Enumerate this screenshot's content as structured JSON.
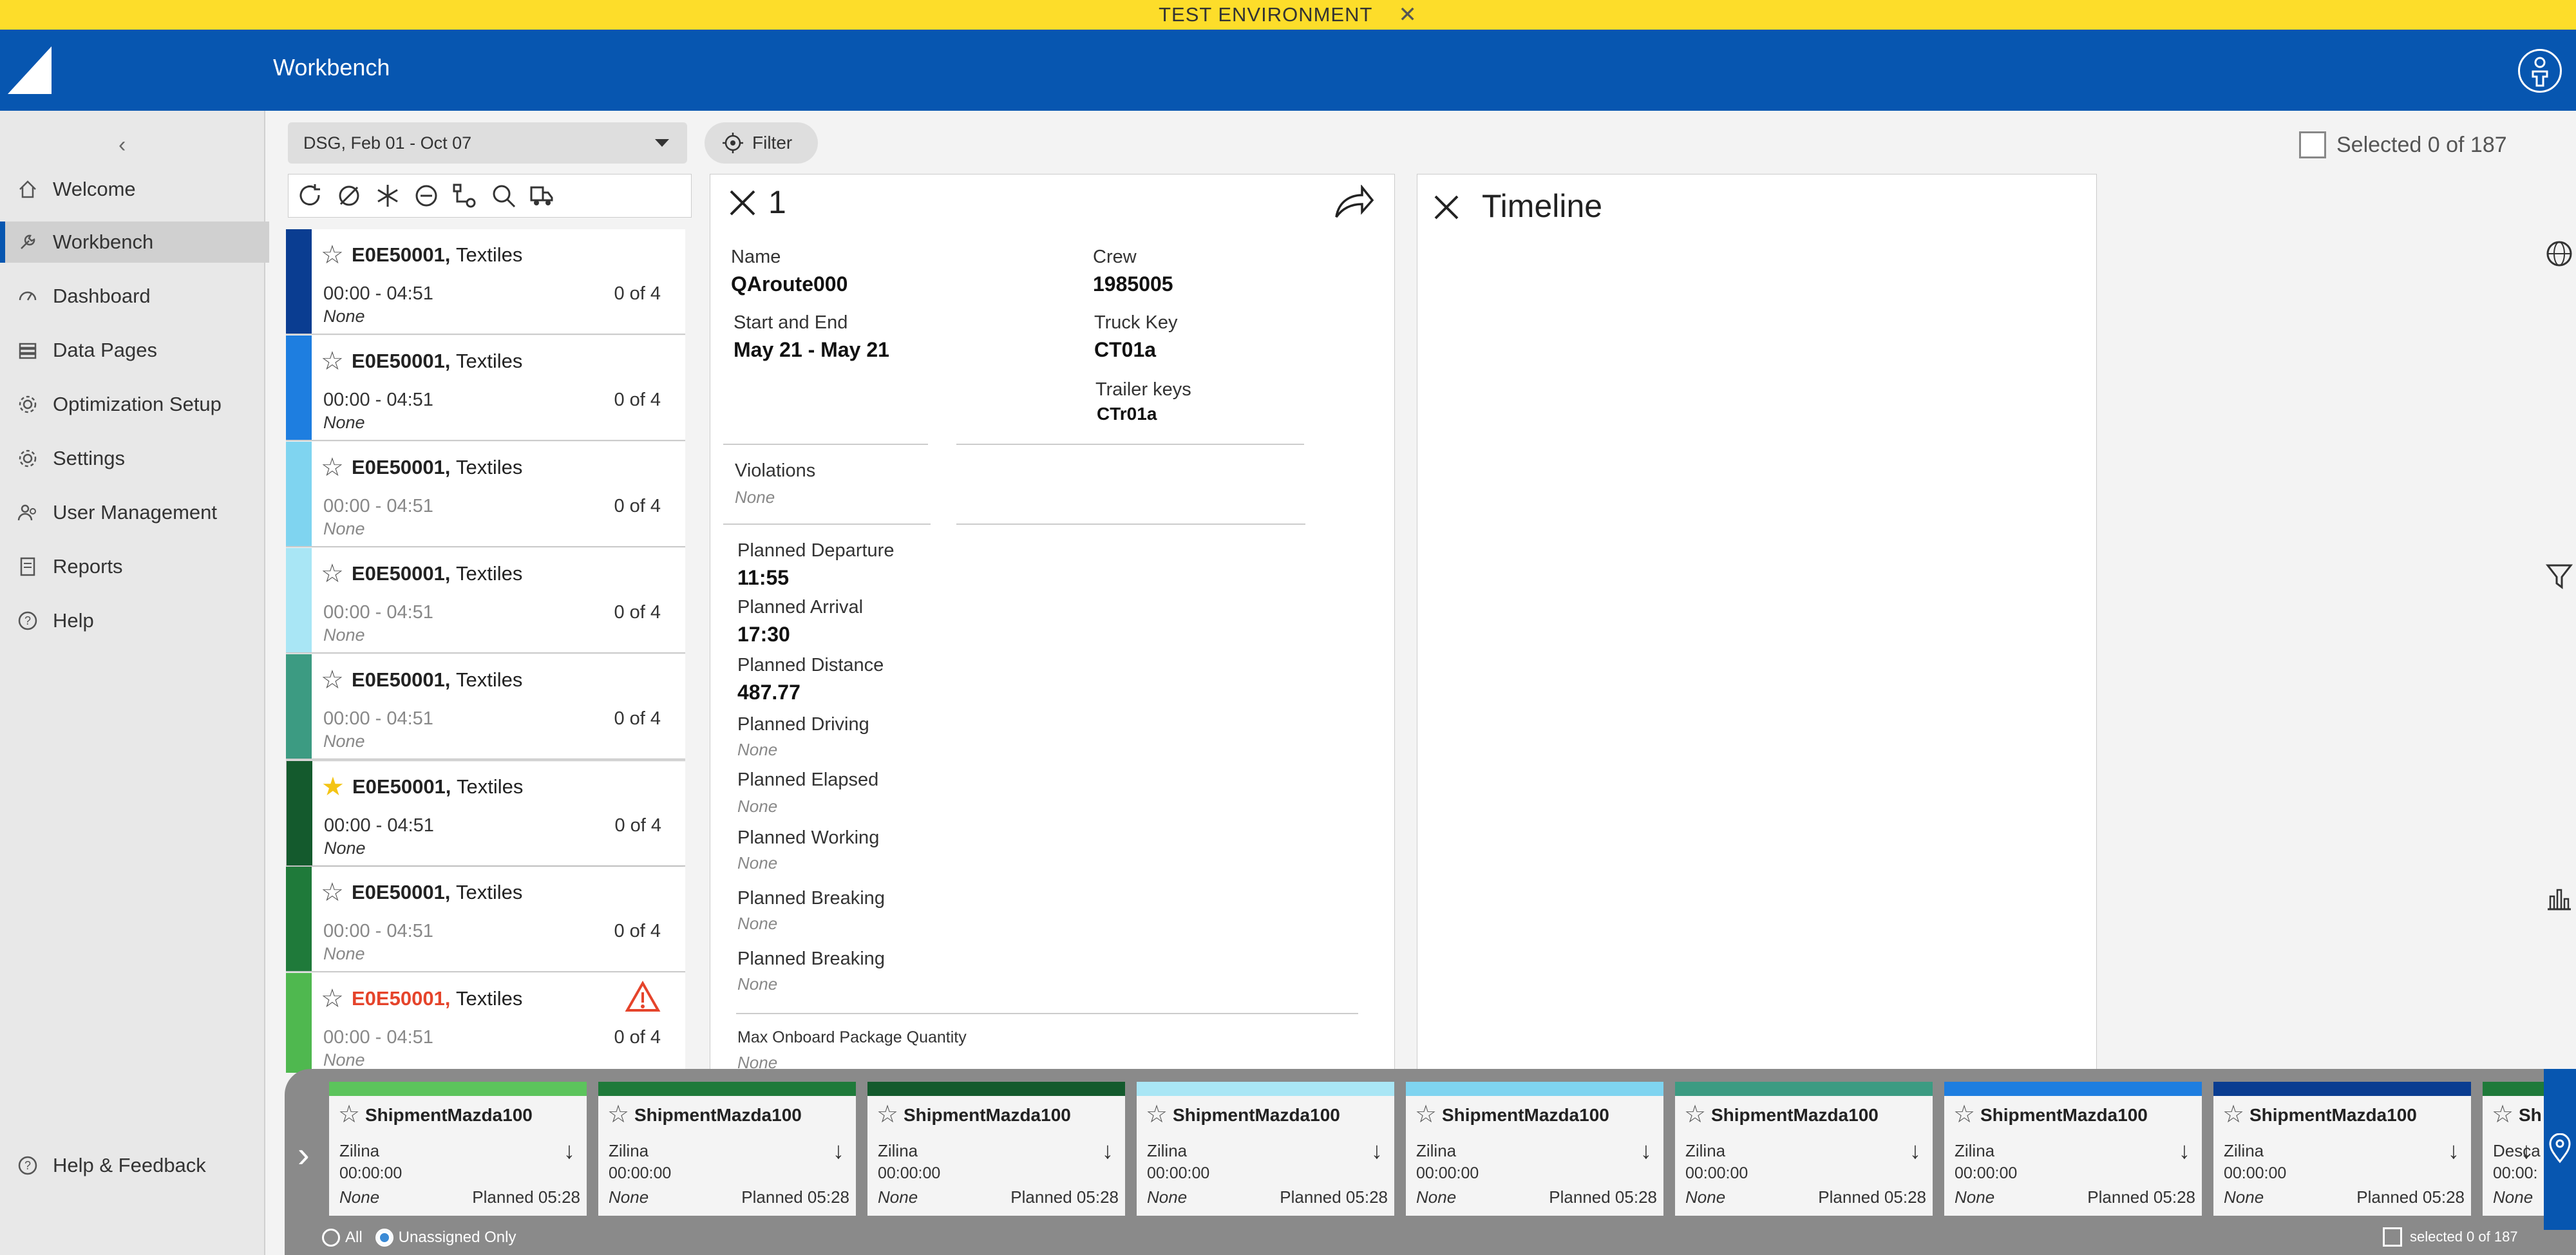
{
  "banner": {
    "text": "TEST ENVIRONMENT",
    "close": "✕"
  },
  "header": {
    "title": "Workbench"
  },
  "sidebar": {
    "collapse": "‹",
    "items": [
      {
        "label": "Welcome",
        "icon": "home-icon"
      },
      {
        "label": "Workbench",
        "icon": "wrench-icon",
        "active": true
      },
      {
        "label": "Dashboard",
        "icon": "dashboard-icon"
      },
      {
        "label": "Data Pages",
        "icon": "database-icon"
      },
      {
        "label": "Optimization Setup",
        "icon": "gear-icon"
      },
      {
        "label": "Settings",
        "icon": "gear-icon"
      },
      {
        "label": "User Management",
        "icon": "users-icon"
      },
      {
        "label": "Reports",
        "icon": "report-icon"
      },
      {
        "label": "Help",
        "icon": "help-icon"
      }
    ],
    "feedback": "Help & Feedback"
  },
  "toolbar": {
    "date_range": "DSG, Feb 01 - Oct 07",
    "filter_label": "Filter",
    "selected_text": "Selected 0 of 187"
  },
  "routes": [
    {
      "id": "E0E50001,",
      "cat": "Textiles",
      "time": "00:00 - 04:51",
      "count": "0 of 4",
      "none": "None",
      "colors": [
        "#0a3d91"
      ],
      "fav": false,
      "dim": false
    },
    {
      "id": "E0E50001,",
      "cat": "Textiles",
      "time": "00:00 - 04:51",
      "count": "0 of 4",
      "none": "None",
      "colors": [
        "#1e7ee0"
      ],
      "fav": false,
      "dim": false
    },
    {
      "id": "E0E50001,",
      "cat": "Textiles",
      "time": "00:00 - 04:51",
      "count": "0 of 4",
      "none": "None",
      "colors": [
        "#7fd4f0"
      ],
      "fav": false,
      "dim": true
    },
    {
      "id": "E0E50001,",
      "cat": "Textiles",
      "time": "00:00 - 04:51",
      "count": "0 of 4",
      "none": "None",
      "colors": [
        "#a9e6f5"
      ],
      "fav": false,
      "dim": true
    },
    {
      "id": "E0E50001,",
      "cat": "Textiles",
      "time": "00:00 - 04:51",
      "count": "0 of 4",
      "none": "None",
      "colors": [
        "#3c9b82"
      ],
      "fav": false,
      "dim": true
    },
    {
      "id": "E0E50001,",
      "cat": "Textiles",
      "time": "00:00 - 04:51",
      "count": "0 of 4",
      "none": "None",
      "colors": [
        "#145a2d"
      ],
      "fav": true,
      "dim": false
    },
    {
      "id": "E0E50001,",
      "cat": "Textiles",
      "time": "00:00 - 04:51",
      "count": "0 of 4",
      "none": "None",
      "colors": [
        "#1f7a3a"
      ],
      "fav": false,
      "dim": true
    },
    {
      "id": "E0E50001,",
      "cat": "Textiles",
      "time": "00:00 - 04:51",
      "count": "0 of 4",
      "none": "None",
      "colors": [
        "#4fb84f"
      ],
      "fav": false,
      "dim": true,
      "warn": true,
      "red": true
    }
  ],
  "details": {
    "title": "1",
    "name_label": "Name",
    "name": "QAroute000",
    "crew_label": "Crew",
    "crew": "1985005",
    "se_label": "Start and End",
    "se": "May 21 - May 21",
    "truck_label": "Truck Key",
    "truck": "CT01a",
    "trailer_label": "Trailer keys",
    "trailer": "CTr01a",
    "violations_label": "Violations",
    "violations": "None",
    "pd_label": "Planned Departure",
    "pd": "11:55",
    "pa_label": "Planned Arrival",
    "pa": "17:30",
    "pdist_label": "Planned Distance",
    "pdist": "487.77",
    "pdrive_label": "Planned Driving",
    "pdrive": "None",
    "pelapsed_label": "Planned Elapsed",
    "pelapsed": "None",
    "pwork_label": "Planned Working",
    "pwork": "None",
    "pbreak1_label": "Planned Breaking",
    "pbreak1": "None",
    "pbreak2_label": "Planned Breaking",
    "pbreak2": "None",
    "maxpkg_label": "Max Onboard Package Quantity",
    "maxpkg": "None"
  },
  "timeline": {
    "title": "Timeline"
  },
  "shipments": [
    {
      "name": "ShipmentMazda100",
      "city": "Zilina",
      "clock": "00:00:00",
      "none": "None",
      "planned": "Planned 05:28",
      "color": "#5cc45c"
    },
    {
      "name": "ShipmentMazda100",
      "city": "Zilina",
      "clock": "00:00:00",
      "none": "None",
      "planned": "Planned 05:28",
      "color": "#1f7a3a"
    },
    {
      "name": "ShipmentMazda100",
      "city": "Zilina",
      "clock": "00:00:00",
      "none": "None",
      "planned": "Planned 05:28",
      "color": "#145a2d"
    },
    {
      "name": "ShipmentMazda100",
      "city": "Zilina",
      "clock": "00:00:00",
      "none": "None",
      "planned": "Planned 05:28",
      "color": "#a9e6f5"
    },
    {
      "name": "ShipmentMazda100",
      "city": "Zilina",
      "clock": "00:00:00",
      "none": "None",
      "planned": "Planned 05:28",
      "color": "#7fd4f0"
    },
    {
      "name": "ShipmentMazda100",
      "city": "Zilina",
      "clock": "00:00:00",
      "none": "None",
      "planned": "Planned 05:28",
      "color": "#3c9b82"
    },
    {
      "name": "ShipmentMazda100",
      "city": "Zilina",
      "clock": "00:00:00",
      "none": "None",
      "planned": "Planned 05:28",
      "color": "#1e7ee0"
    },
    {
      "name": "ShipmentMazda100",
      "city": "Zilina",
      "clock": "00:00:00",
      "none": "None",
      "planned": "Planned 05:28",
      "color": "#0a3d91"
    },
    {
      "name": "Sh",
      "city": "Desca",
      "clock": "00:00:",
      "none": "None",
      "planned": "",
      "color": "#1f7a3a"
    }
  ],
  "tray": {
    "all_label": "All",
    "unassigned_label": "Unassigned Only",
    "selected_text": "selected 0 of 187"
  }
}
